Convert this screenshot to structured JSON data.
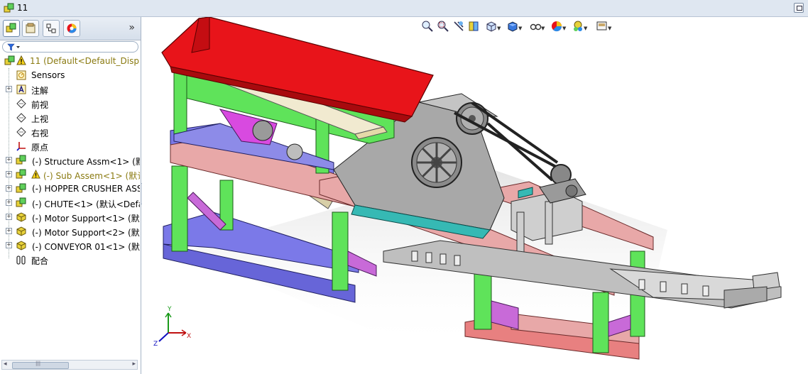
{
  "window": {
    "title": "11"
  },
  "panel": {
    "collapse_chevron": "»",
    "tree": {
      "root": "11  (Default<Default_Displ",
      "items": [
        {
          "label": "Sensors",
          "icon": "sensor-icon",
          "expandable": false
        },
        {
          "label": "注解",
          "icon": "annotation-icon",
          "expandable": true
        },
        {
          "label": "前视",
          "icon": "plane-icon",
          "expandable": false
        },
        {
          "label": "上视",
          "icon": "plane-icon",
          "expandable": false
        },
        {
          "label": "右视",
          "icon": "plane-icon",
          "expandable": false
        },
        {
          "label": "原点",
          "icon": "origin-icon",
          "expandable": false
        },
        {
          "label": "(-) Structure Assm<1> (默",
          "icon": "assembly-icon",
          "expandable": true
        },
        {
          "label": "(-) Sub Assem<1> (默认",
          "icon": "assembly-warning-icon",
          "expandable": true,
          "warning": true
        },
        {
          "label": "(-) HOPPER CRUSHER ASS",
          "icon": "assembly-icon",
          "expandable": true
        },
        {
          "label": "(-) CHUTE<1> (默认<Defa",
          "icon": "assembly-icon",
          "expandable": true
        },
        {
          "label": "(-) Motor Support<1> (默",
          "icon": "part-icon",
          "expandable": true
        },
        {
          "label": "(-) Motor Support<2> (默",
          "icon": "part-icon",
          "expandable": true
        },
        {
          "label": "(-) CONVEYOR 01<1> (默",
          "icon": "part-icon",
          "expandable": true
        },
        {
          "label": "配合",
          "icon": "mates-icon",
          "expandable": false
        }
      ]
    }
  },
  "colors": {
    "hopper": "#e8141a",
    "frame_green": "#5fe35a",
    "beam_pink": "#e8a8a8",
    "base_blue": "#7b79e8",
    "crusher_gray": "#a8a8a8"
  },
  "hud": [
    "zoom-to-fit-icon",
    "zoom-area-icon",
    "previous-view-icon",
    "section-view-icon",
    "view-orientation-icon",
    "display-style-icon",
    "hide-show-icon",
    "appearance-icon",
    "scene-icon",
    "view-settings-icon"
  ]
}
